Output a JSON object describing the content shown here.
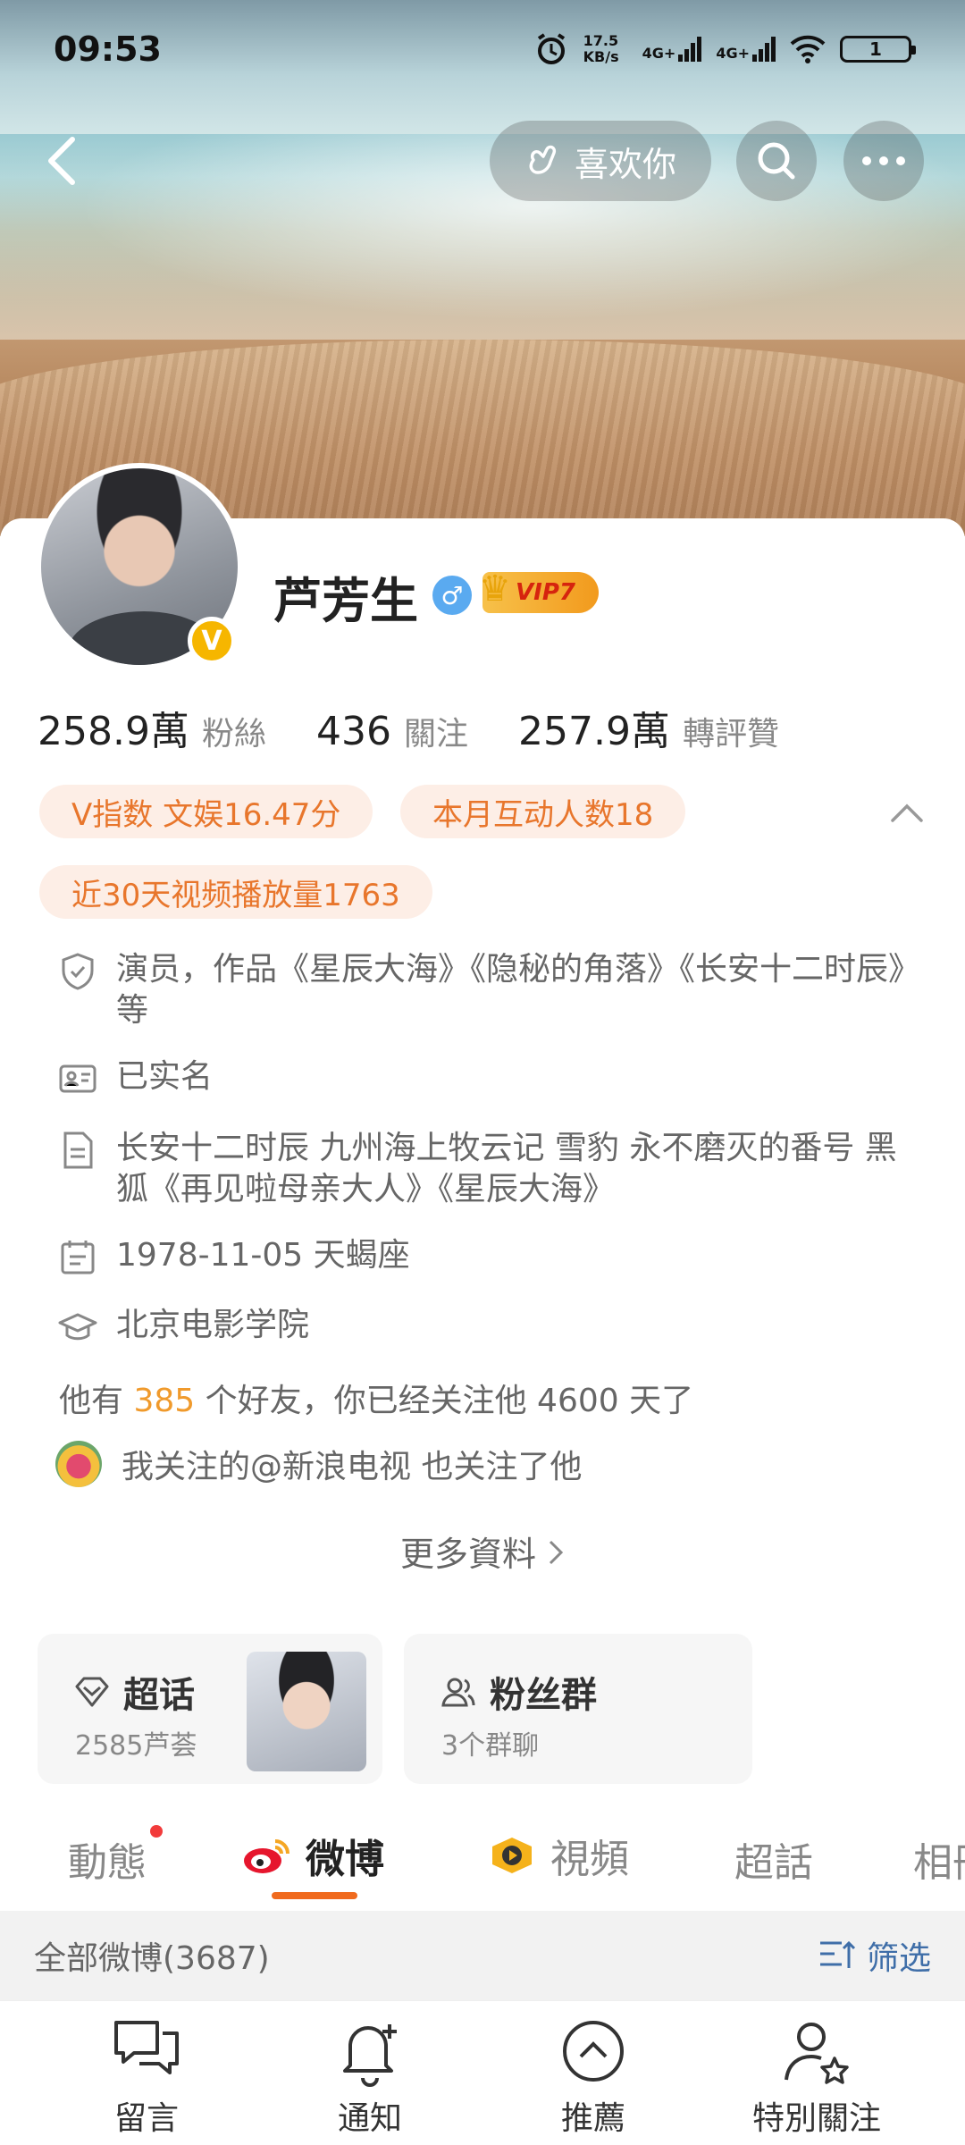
{
  "status_bar": {
    "time": "09:53",
    "net_speed": "17.5 KB/s",
    "signal1": "4G+",
    "signal2": "4G+",
    "battery": "1"
  },
  "header": {
    "like_button": "喜欢你"
  },
  "profile": {
    "name": "芦芳生",
    "vip_label": "VIP7",
    "verified_mark": "V",
    "stats": [
      {
        "value": "258.9萬",
        "label": "粉絲"
      },
      {
        "value": "436",
        "label": "關注"
      },
      {
        "value": "257.9萬",
        "label": "轉評贊"
      }
    ],
    "chips": [
      "V指数 文娱16.47分",
      "本月互动人数18",
      "近30天视频播放量1763"
    ],
    "info": [
      {
        "icon": "shield-icon",
        "text": "演员，作品《星辰大海》《隐秘的角落》《长安十二时辰》等"
      },
      {
        "icon": "id-card-icon",
        "text": "已实名"
      },
      {
        "icon": "document-icon",
        "text": "长安十二时辰 九州海上牧云记 雪豹 永不磨灭的番号 黑狐《再见啦母亲大人》《星辰大海》"
      },
      {
        "icon": "calendar-icon",
        "text": "1978-11-05 天蝎座"
      },
      {
        "icon": "graduation-cap-icon",
        "text": "北京电影学院"
      }
    ],
    "friends": {
      "prefix": "他有 ",
      "count": "385",
      "suffix": " 个好友，你已经关注他 4600 天了"
    },
    "mutual": "我关注的@新浪电视  也关注了他",
    "more": "更多資料"
  },
  "boxes": {
    "super_topic": {
      "title": "超话",
      "sub": "2585芦荟"
    },
    "fan_group": {
      "title": "粉丝群",
      "sub": "3个群聊"
    }
  },
  "tabs": [
    "動態",
    "微博",
    "視頻",
    "超話",
    "相冊"
  ],
  "filter_bar": {
    "label": "全部微博(3687)",
    "filter": "筛选"
  },
  "bottom_nav": [
    "留言",
    "通知",
    "推薦",
    "特別關注"
  ],
  "colors": {
    "accent": "#f06a1e",
    "chip_text": "#e8762c",
    "link_blue": "#3f6ea8"
  }
}
